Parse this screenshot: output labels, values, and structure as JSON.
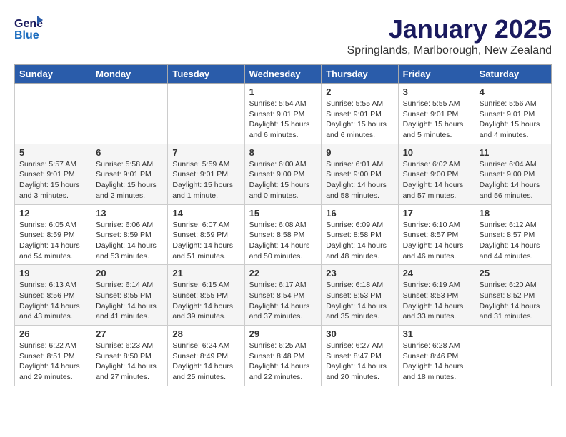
{
  "header": {
    "logo_general": "General",
    "logo_blue": "Blue",
    "month": "January 2025",
    "location": "Springlands, Marlborough, New Zealand"
  },
  "weekdays": [
    "Sunday",
    "Monday",
    "Tuesday",
    "Wednesday",
    "Thursday",
    "Friday",
    "Saturday"
  ],
  "weeks": [
    [
      {
        "day": "",
        "info": ""
      },
      {
        "day": "",
        "info": ""
      },
      {
        "day": "",
        "info": ""
      },
      {
        "day": "1",
        "info": "Sunrise: 5:54 AM\nSunset: 9:01 PM\nDaylight: 15 hours\nand 6 minutes."
      },
      {
        "day": "2",
        "info": "Sunrise: 5:55 AM\nSunset: 9:01 PM\nDaylight: 15 hours\nand 6 minutes."
      },
      {
        "day": "3",
        "info": "Sunrise: 5:55 AM\nSunset: 9:01 PM\nDaylight: 15 hours\nand 5 minutes."
      },
      {
        "day": "4",
        "info": "Sunrise: 5:56 AM\nSunset: 9:01 PM\nDaylight: 15 hours\nand 4 minutes."
      }
    ],
    [
      {
        "day": "5",
        "info": "Sunrise: 5:57 AM\nSunset: 9:01 PM\nDaylight: 15 hours\nand 3 minutes."
      },
      {
        "day": "6",
        "info": "Sunrise: 5:58 AM\nSunset: 9:01 PM\nDaylight: 15 hours\nand 2 minutes."
      },
      {
        "day": "7",
        "info": "Sunrise: 5:59 AM\nSunset: 9:01 PM\nDaylight: 15 hours\nand 1 minute."
      },
      {
        "day": "8",
        "info": "Sunrise: 6:00 AM\nSunset: 9:00 PM\nDaylight: 15 hours\nand 0 minutes."
      },
      {
        "day": "9",
        "info": "Sunrise: 6:01 AM\nSunset: 9:00 PM\nDaylight: 14 hours\nand 58 minutes."
      },
      {
        "day": "10",
        "info": "Sunrise: 6:02 AM\nSunset: 9:00 PM\nDaylight: 14 hours\nand 57 minutes."
      },
      {
        "day": "11",
        "info": "Sunrise: 6:04 AM\nSunset: 9:00 PM\nDaylight: 14 hours\nand 56 minutes."
      }
    ],
    [
      {
        "day": "12",
        "info": "Sunrise: 6:05 AM\nSunset: 8:59 PM\nDaylight: 14 hours\nand 54 minutes."
      },
      {
        "day": "13",
        "info": "Sunrise: 6:06 AM\nSunset: 8:59 PM\nDaylight: 14 hours\nand 53 minutes."
      },
      {
        "day": "14",
        "info": "Sunrise: 6:07 AM\nSunset: 8:59 PM\nDaylight: 14 hours\nand 51 minutes."
      },
      {
        "day": "15",
        "info": "Sunrise: 6:08 AM\nSunset: 8:58 PM\nDaylight: 14 hours\nand 50 minutes."
      },
      {
        "day": "16",
        "info": "Sunrise: 6:09 AM\nSunset: 8:58 PM\nDaylight: 14 hours\nand 48 minutes."
      },
      {
        "day": "17",
        "info": "Sunrise: 6:10 AM\nSunset: 8:57 PM\nDaylight: 14 hours\nand 46 minutes."
      },
      {
        "day": "18",
        "info": "Sunrise: 6:12 AM\nSunset: 8:57 PM\nDaylight: 14 hours\nand 44 minutes."
      }
    ],
    [
      {
        "day": "19",
        "info": "Sunrise: 6:13 AM\nSunset: 8:56 PM\nDaylight: 14 hours\nand 43 minutes."
      },
      {
        "day": "20",
        "info": "Sunrise: 6:14 AM\nSunset: 8:55 PM\nDaylight: 14 hours\nand 41 minutes."
      },
      {
        "day": "21",
        "info": "Sunrise: 6:15 AM\nSunset: 8:55 PM\nDaylight: 14 hours\nand 39 minutes."
      },
      {
        "day": "22",
        "info": "Sunrise: 6:17 AM\nSunset: 8:54 PM\nDaylight: 14 hours\nand 37 minutes."
      },
      {
        "day": "23",
        "info": "Sunrise: 6:18 AM\nSunset: 8:53 PM\nDaylight: 14 hours\nand 35 minutes."
      },
      {
        "day": "24",
        "info": "Sunrise: 6:19 AM\nSunset: 8:53 PM\nDaylight: 14 hours\nand 33 minutes."
      },
      {
        "day": "25",
        "info": "Sunrise: 6:20 AM\nSunset: 8:52 PM\nDaylight: 14 hours\nand 31 minutes."
      }
    ],
    [
      {
        "day": "26",
        "info": "Sunrise: 6:22 AM\nSunset: 8:51 PM\nDaylight: 14 hours\nand 29 minutes."
      },
      {
        "day": "27",
        "info": "Sunrise: 6:23 AM\nSunset: 8:50 PM\nDaylight: 14 hours\nand 27 minutes."
      },
      {
        "day": "28",
        "info": "Sunrise: 6:24 AM\nSunset: 8:49 PM\nDaylight: 14 hours\nand 25 minutes."
      },
      {
        "day": "29",
        "info": "Sunrise: 6:25 AM\nSunset: 8:48 PM\nDaylight: 14 hours\nand 22 minutes."
      },
      {
        "day": "30",
        "info": "Sunrise: 6:27 AM\nSunset: 8:47 PM\nDaylight: 14 hours\nand 20 minutes."
      },
      {
        "day": "31",
        "info": "Sunrise: 6:28 AM\nSunset: 8:46 PM\nDaylight: 14 hours\nand 18 minutes."
      },
      {
        "day": "",
        "info": ""
      }
    ]
  ]
}
